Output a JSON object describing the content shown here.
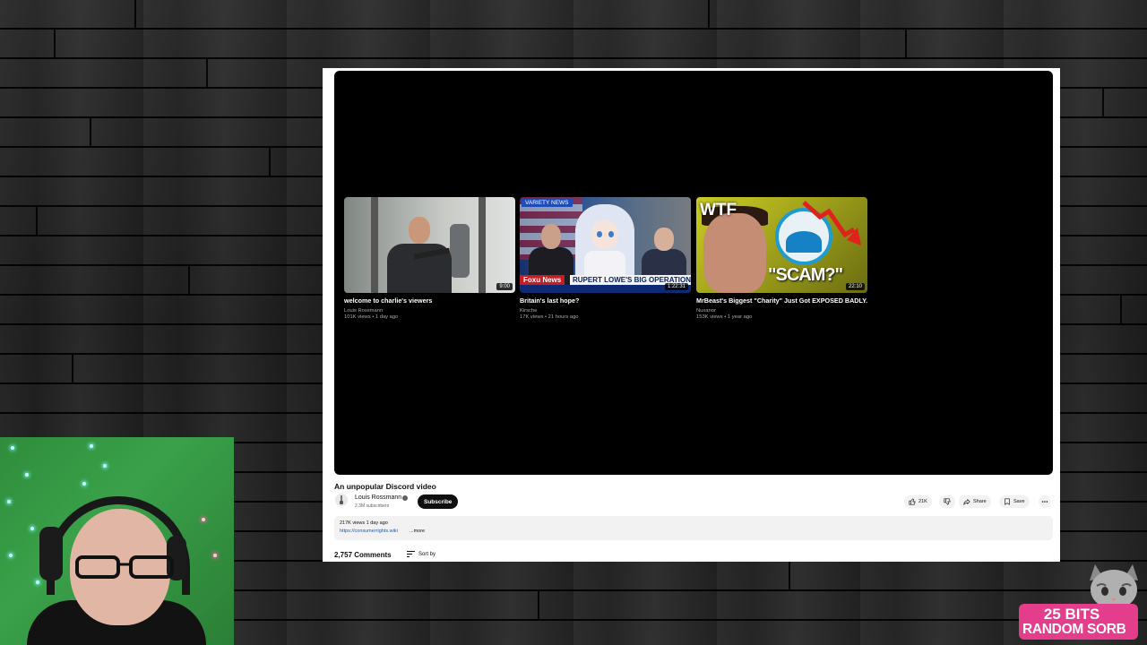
{
  "player": {
    "end_screen": [
      {
        "title": "welcome to charlie's viewers",
        "channel": "Louis Rossmann",
        "meta": "101K views • 1 day ago",
        "duration": "9:00"
      },
      {
        "title": "Britain's last hope?",
        "channel": "Kirsche",
        "meta": "17K views • 21 hours ago",
        "duration": "1:22:31",
        "thumb_text": {
          "top_banner": "VARIETY NEWS",
          "network": "Foxu News",
          "headline": "RUPERT LOWE'S BIG OPERATION"
        }
      },
      {
        "title": "MrBeast's Biggest \"Charity\" Just Got EXPOSED BADLY...",
        "channel": "Nuxanor",
        "meta": "153K views • 1 year ago",
        "duration": "22:10",
        "thumb_text": {
          "top": "WTF",
          "bottom": "\"SCAM?\""
        }
      }
    ]
  },
  "video": {
    "title": "An unpopular Discord video",
    "channel_name": "Louis Rossmann",
    "subscribers": "2.3M subscribers",
    "subscribe_label": "Subscribe",
    "likes": "21K",
    "share_label": "Share",
    "save_label": "Save"
  },
  "description": {
    "stats": "217K views  1 day ago",
    "link": "https://consumerrights.wiki",
    "more": "...more"
  },
  "comments": {
    "count": "2,757 Comments",
    "sort_label": "Sort by"
  },
  "overlay": {
    "bits_line1": "25 BITS",
    "bits_line2": "RANDOM SORB"
  },
  "colors": {
    "subscribe_bg": "#0f0f0f",
    "link": "#065fd4",
    "badge": "#e33d8b"
  }
}
